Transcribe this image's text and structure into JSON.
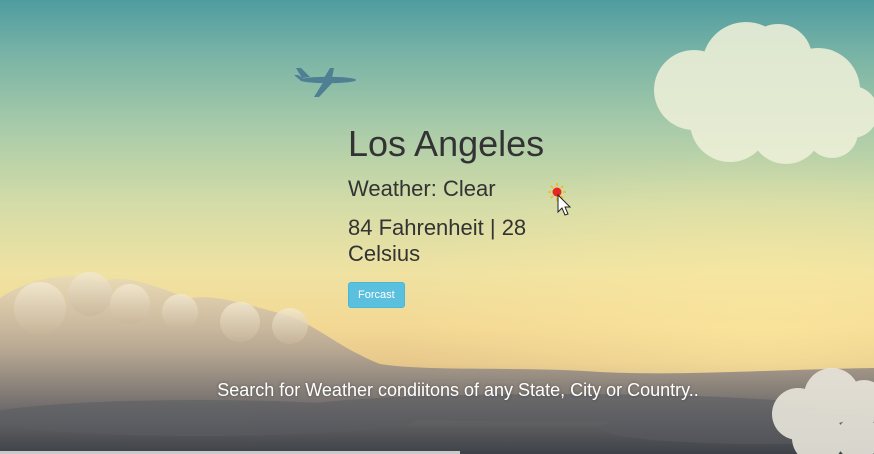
{
  "weather": {
    "city": "Los Angeles",
    "condition_line": "Weather: Clear",
    "temperature_line": "84 Fahrenheit | 28 Celsius",
    "forecast_button_label": "Forcast"
  },
  "search": {
    "hint_text": "Search for Weather condiitons of any State, City or Country.."
  },
  "colors": {
    "button_bg": "#5bc0de",
    "text": "#333333",
    "hint_text": "#ffffff"
  },
  "icons": [
    "airplane-icon",
    "sun-cursor-icon"
  ]
}
